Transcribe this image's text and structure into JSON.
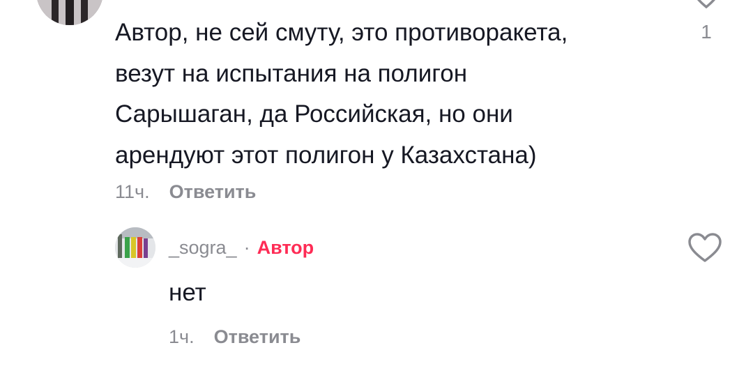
{
  "top_comment": {
    "text": "Автор, не сей смуту, это противоракета,\nвезут на испытания на полигон\nСарышаган, да Российская, но они\nарендуют этот полигон у Казахстана)",
    "time": "11ч.",
    "reply_label": "Ответить",
    "like_count": "1",
    "avatar_icon": "user-avatar-photo",
    "like_icon": "heart-icon"
  },
  "reply": {
    "username": "_sogra_",
    "separator": "·",
    "author_badge": "Автор",
    "text": "нет",
    "time": "1ч.",
    "reply_label": "Ответить",
    "avatar_icon": "user-avatar-photo",
    "like_icon": "heart-icon"
  },
  "colors": {
    "text_primary": "#161823",
    "text_secondary": "#8a8b91",
    "author_badge": "#fe2c55"
  }
}
